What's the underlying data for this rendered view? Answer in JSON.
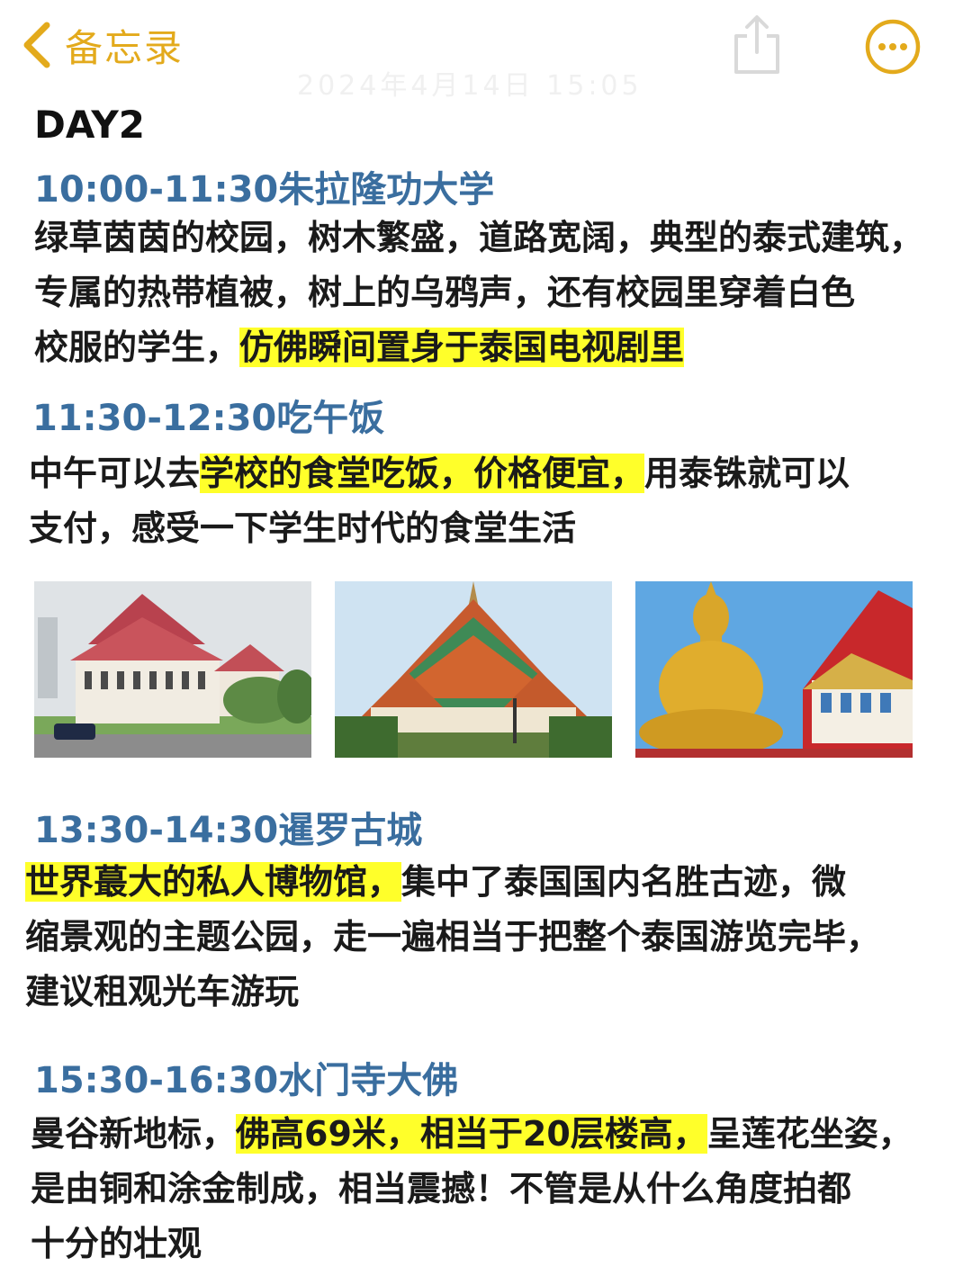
{
  "nav": {
    "back_label": "备忘录",
    "ghost_text": "2024年4月14日 15:05"
  },
  "note": {
    "day_title": "DAY2",
    "sections": [
      {
        "time": "10:00-11:30朱拉隆功大学",
        "lines": [
          {
            "plain1": "绿草茵茵的校园，树木繁盛，道路宽阔，典型的泰式建筑，",
            "highlight": "",
            "plain2": ""
          },
          {
            "plain1": "专属的热带植被，树上的乌鸦声，还有校园里穿着白色",
            "highlight": "",
            "plain2": ""
          },
          {
            "plain1": "校服的学生，",
            "highlight": "仿佛瞬间置身于泰国电视剧里",
            "plain2": ""
          }
        ]
      },
      {
        "time": "11:30-12:30吃午饭",
        "lines": [
          {
            "plain1": "中午可以去",
            "highlight": "学校的食堂吃饭，价格便宜，",
            "plain2": "用泰铢就可以"
          },
          {
            "plain1": "支付，感受一下学生时代的食堂生活",
            "highlight": "",
            "plain2": ""
          }
        ]
      },
      {
        "time": "13:30-14:30暹罗古城",
        "lines": [
          {
            "plain1": "",
            "highlight": "世界蕞大的私人博物馆，",
            "plain2": "集中了泰国国内名胜古迹，微"
          },
          {
            "plain1": "缩景观的主题公园，走一遍相当于把整个泰国游览完毕，",
            "highlight": "",
            "plain2": ""
          },
          {
            "plain1": "建议租观光车游玩",
            "highlight": "",
            "plain2": ""
          }
        ]
      },
      {
        "time": "15:30-16:30水门寺大佛",
        "lines": [
          {
            "plain1": "曼谷新地标，",
            "highlight": "佛高69米，相当于20层楼高，",
            "plain2": "呈莲花坐姿，"
          },
          {
            "plain1": "是由铜和涂金制成，相当震撼！不管是从什么角度拍都",
            "highlight": "",
            "plain2": ""
          },
          {
            "plain1": "十分的壮观",
            "highlight": "",
            "plain2": ""
          }
        ]
      }
    ]
  },
  "colors": {
    "accent": "#e3aa1c",
    "time_heading": "#3a6e9f",
    "highlight": "#ffff2a",
    "body_text": "#1a1a1a"
  },
  "icons": {
    "back": "chevron-left-icon",
    "share": "share-icon",
    "more": "more-icon"
  }
}
